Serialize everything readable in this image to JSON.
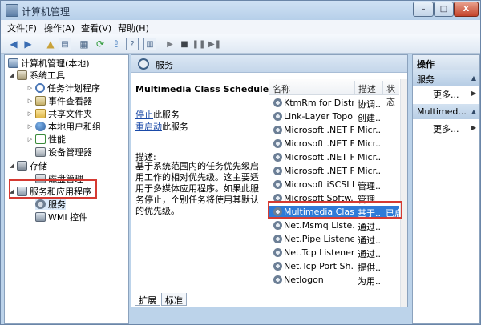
{
  "window": {
    "title": "计算机管理",
    "controls": {
      "minimize": "–",
      "maximize": "□",
      "close": "X"
    }
  },
  "menu": [
    {
      "label": "文件(F)"
    },
    {
      "label": "操作(A)"
    },
    {
      "label": "查看(V)"
    },
    {
      "label": "帮助(H)"
    }
  ],
  "toolbar": {
    "icons": [
      "back-arrow-icon",
      "forward-arrow-icon",
      "up-folder-icon",
      "show-tree-icon",
      "properties-icon",
      "refresh-icon",
      "export-icon",
      "help-icon",
      "action-pane-icon",
      "play-icon",
      "stop-icon",
      "pause-icon",
      "restart-icon"
    ]
  },
  "tree": {
    "root": "计算机管理(本地)",
    "system_tools": "系统工具",
    "task_scheduler": "任务计划程序",
    "event_viewer": "事件查看器",
    "shared_folders": "共享文件夹",
    "local_users": "本地用户和组",
    "performance": "性能",
    "device_manager": "设备管理器",
    "storage": "存储",
    "disk_mgmt": "磁盘管理",
    "services_apps": "服务和应用程序",
    "services": "服务",
    "wmi": "WMI 控件"
  },
  "middle": {
    "header": "服务",
    "service_title": "Multimedia Class Scheduler",
    "stop_link": "停止",
    "stop_suffix": "此服务",
    "restart_link": "重启动",
    "restart_suffix": "此服务",
    "desc_label": "描述:",
    "description": "基于系统范围内的任务优先级启用工作的相对优先级。这主要适用于多媒体应用程序。如果此服务停止，个别任务将使用其默认的优先级。",
    "columns": {
      "name": "名称",
      "desc": "描述",
      "status": "状态"
    },
    "services": [
      {
        "name": "KtmRm for Distri...",
        "desc": "协调...",
        "status": ""
      },
      {
        "name": "Link-Layer Topol...",
        "desc": "创建...",
        "status": ""
      },
      {
        "name": "Microsoft .NET F...",
        "desc": "Micr...",
        "status": ""
      },
      {
        "name": "Microsoft .NET F...",
        "desc": "Micr...",
        "status": ""
      },
      {
        "name": "Microsoft .NET F...",
        "desc": "Micr...",
        "status": ""
      },
      {
        "name": "Microsoft .NET F...",
        "desc": "Micr...",
        "status": ""
      },
      {
        "name": "Microsoft iSCSI I...",
        "desc": "管理...",
        "status": ""
      },
      {
        "name": "Microsoft Softw...",
        "desc": "管理...",
        "status": ""
      },
      {
        "name": "Multimedia Clas...",
        "desc": "基于...",
        "status": "已启"
      },
      {
        "name": "Net.Msmq Liste...",
        "desc": "通过...",
        "status": ""
      },
      {
        "name": "Net.Pipe Listene...",
        "desc": "通过...",
        "status": ""
      },
      {
        "name": "Net.Tcp Listener...",
        "desc": "通过...",
        "status": ""
      },
      {
        "name": "Net.Tcp Port Sh...",
        "desc": "提供...",
        "status": ""
      },
      {
        "name": "Netlogon",
        "desc": "为用...",
        "status": ""
      }
    ],
    "tabs": {
      "extended": "扩展",
      "standard": "标准"
    }
  },
  "actions": {
    "title": "操作",
    "section1": "服务",
    "more1": "更多...",
    "section2": "Multimed...",
    "more2": "更多..."
  }
}
